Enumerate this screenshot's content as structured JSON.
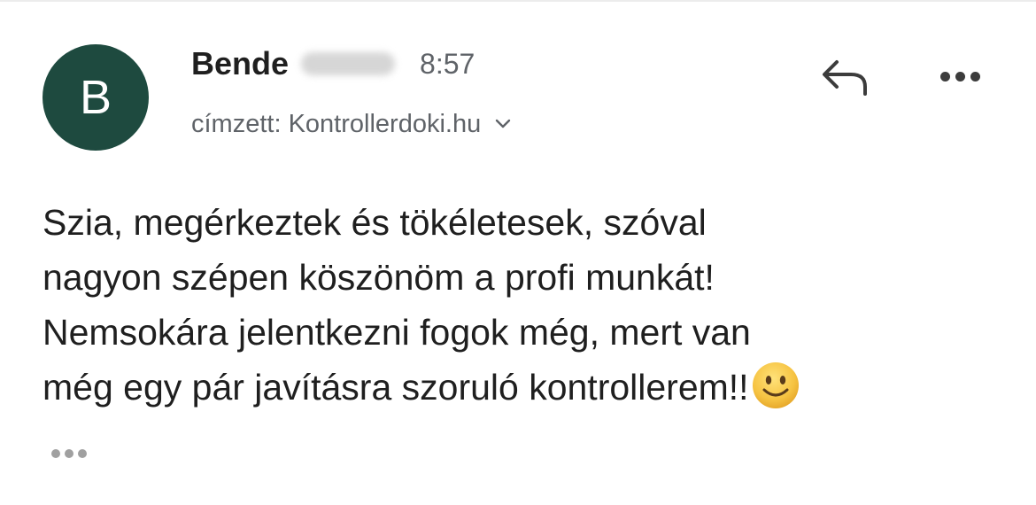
{
  "message": {
    "avatar_letter": "B",
    "avatar_color": "#1e4a3f",
    "sender_first_name": "Bende",
    "time": "8:57",
    "recipient_label": "címzett:",
    "recipient": "Kontrollerdoki.hu",
    "body_lines": [
      "Szia, megérkeztek és tökéletesek, szóval",
      "nagyon szépen köszönöm a profi munkát!",
      "Nemsokára jelentkezni fogok még, mert van",
      "még egy pár javításra szoruló kontrollerem!!"
    ],
    "trailing_emoji": "slightly-smiling-face-icon"
  },
  "actions": {
    "reply_icon": "reply-icon",
    "more_icon": "more-options-icon",
    "expand_recipients_icon": "chevron-down-icon",
    "show_trimmed_icon": "show-trimmed-content-icon"
  },
  "colors": {
    "primary_text": "#1f1f1f",
    "secondary_text": "#5f6368",
    "emoji_face": "#f6c342"
  }
}
